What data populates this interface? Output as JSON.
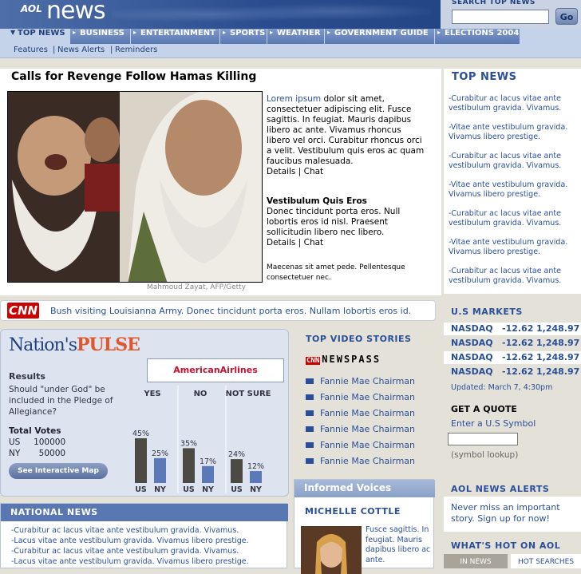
{
  "header": {
    "logo_aol": "AOL",
    "logo_news": "news",
    "search_title": "SEARCH TOP NEWS",
    "search_go": "Go"
  },
  "nav": {
    "tabs": [
      "TOP NEWS",
      "BUSINESS",
      "ENTERTAINMENT",
      "SPORTS",
      "WEATHER",
      "GOVERNMENT GUIDE",
      "ELECTIONS 2004"
    ],
    "subnav": [
      "Features",
      "|",
      "News Alerts",
      "|",
      "Reminders"
    ]
  },
  "lead": {
    "headline": "Calls for Revenge Follow Hamas Killing",
    "photo_credit": "Mahmoud Zayat, AFP/Getty",
    "story1_link": "Lorem ipsum",
    "story1_text": " dolor sit amet, consectetuer adipiscing elit. Fusce sagittis. In feugiat. Mauris dapibus libero ac ante. Vivamus rhoncus libero vel orci. Curabitur rhoncus orci a velit. Vestibulum quis eros ac quam faucibus malesuada.",
    "story1_details": "Details",
    "story1_sep": " | ",
    "story1_chat": "Chat",
    "story2_title": "Vestibulum Quis Eros",
    "story2_text": "Donec tincidunt porta eros. Null lobortis eros id nisl. Praesent sollicitudin libero nec libero.",
    "story2_details": "Details",
    "story2_sep": " | ",
    "story2_chat": "Chat",
    "story3_text": "Maecenas sit amet pede. Pellentesque consectetuer nec."
  },
  "cnn": {
    "logo": "CNN",
    "text": "Bush visiting Louisianna Army.  Donec tincidunt porta eros. Nullam lobortis eros id."
  },
  "pulse": {
    "title_a": "Nation's",
    "title_b": "PULSE",
    "sponsor": "AmericanAirlines",
    "results_label": "Results",
    "question": "Should \"under God\" be included in the Pledge of Allegiance?",
    "total_label": "Total Votes",
    "totals": [
      {
        "state": "US",
        "votes": "100000"
      },
      {
        "state": "NY",
        "votes": "50000"
      }
    ],
    "map_button": "See Interactive Map"
  },
  "chart_data": {
    "type": "bar",
    "categories": [
      "YES",
      "NO",
      "NOT SURE"
    ],
    "sub_categories": [
      "US",
      "NY"
    ],
    "series": [
      {
        "name": "US",
        "values": [
          45,
          35,
          24
        ],
        "color": "#4d4a44"
      },
      {
        "name": "NY",
        "values": [
          25,
          17,
          12
        ],
        "color": "#5b78b8"
      }
    ],
    "labels": [
      [
        "45%",
        "25%"
      ],
      [
        "35%",
        "17%"
      ],
      [
        "24%",
        "12%"
      ]
    ],
    "ylim": [
      0,
      60
    ]
  },
  "top_news": {
    "title": "TOP NEWS",
    "items": [
      "-Curabitur ac lacus vitae ante vestibulum gravida. Vivamus.",
      "-Vitae ante vestibulum gravida. Vivamus libero prestige.",
      "-Curabitur ac lacus vitae ante vestibulum gravida. Vivamus.",
      "-Vitae ante vestibulum gravida. Vivamus libero prestige.",
      "-Curabitur ac lacus vitae ante vestibulum gravida. Vivamus.",
      "-Vitae ante vestibulum gravida. Vivamus libero prestige.",
      "-Curabitur ac lacus vitae ante vestibulum gravida. Vivamus."
    ]
  },
  "markets": {
    "title": "U.S MARKETS",
    "rows": [
      {
        "name": "NASDAQ",
        "change": "-12.62",
        "value": "1,248.97"
      },
      {
        "name": "NASDAQ",
        "change": "-12.62",
        "value": "1,248.97"
      },
      {
        "name": "NASDAQ",
        "change": "-12.62",
        "value": "1,248.97"
      },
      {
        "name": "NASDAQ",
        "change": "-12.62",
        "value": "1,248.97"
      }
    ],
    "updated": "Updated: March 7, 4:30pm",
    "quote_title": "GET A QUOTE",
    "quote_label": "Enter a U.S Symbol",
    "quote_link": "(symbol lookup)"
  },
  "video": {
    "title": "TOP VIDEO STORIES",
    "badge": "CNN",
    "newspass": "NEWSPASS",
    "items": [
      "Fannie Mae Chairman",
      "Fannie Mae Chairman",
      "Fannie Mae Chairman",
      "Fannie Mae Chairman",
      "Fannie Mae Chairman",
      "Fannie Mae Chairman"
    ]
  },
  "informed": {
    "title": "Informed Voices",
    "name": "MICHELLE COTTLE",
    "text": "Fusce sagittis. In feugiat. Mauris dapibus libero ac ante."
  },
  "national": {
    "title": "NATIONAL NEWS",
    "items": [
      "-Curabitur ac lacus vitae ante vestibulum gravida. Vivamus.",
      "-Lacus vitae ante vestibulum gravida. Vivamus libero prestige.",
      "-Curabitur ac lacus vitae ante vestibulum gravida. Vivamus.",
      "-Lacus vitae ante vestibulum gravida. Vivamus libero prestige."
    ]
  },
  "alerts": {
    "title": "AOL NEWS ALERTS",
    "text": "Never miss an important story. Sign up for now!"
  },
  "hot": {
    "title": "WHAT'S HOT ON AOL",
    "tab1": "IN NEWS",
    "tab2": "HOT SEARCHES"
  }
}
